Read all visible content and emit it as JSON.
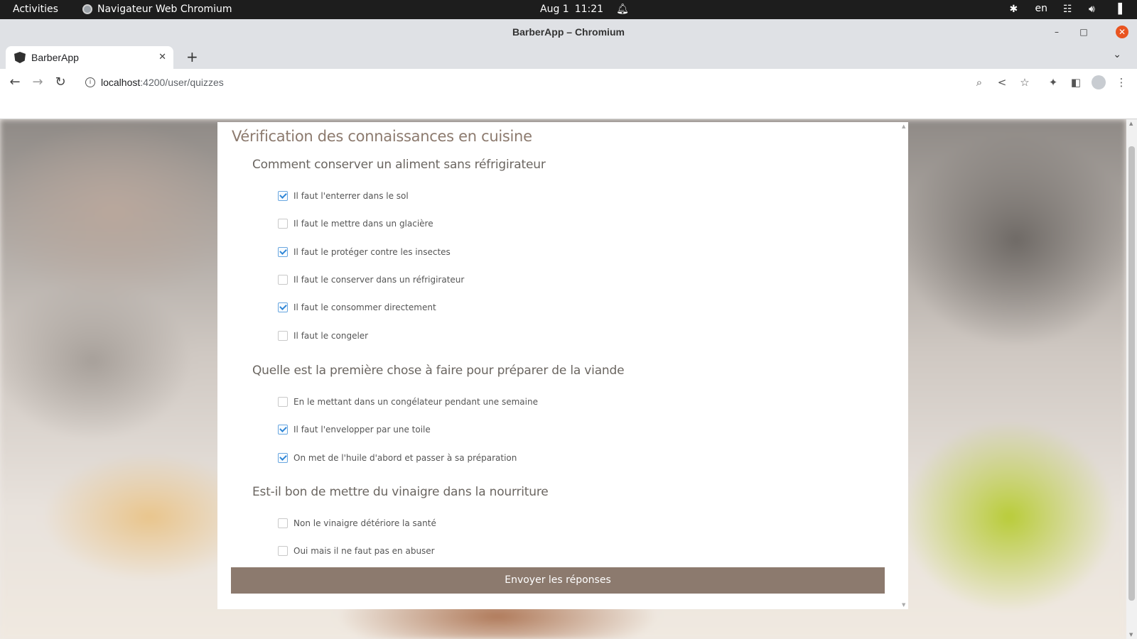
{
  "system_bar": {
    "activities": "Activities",
    "app_name": "Navigateur Web Chromium",
    "date": "Aug 1",
    "time": "11:21",
    "language": "en"
  },
  "window": {
    "title": "BarberApp – Chromium"
  },
  "tab": {
    "title": "BarberApp"
  },
  "address_bar": {
    "host": "localhost",
    "path": ":4200/user/quizzes"
  },
  "quiz": {
    "title": "Vérification des connaissances en cuisine",
    "questions": [
      {
        "text": "Comment conserver un aliment sans réfrigirateur",
        "options": [
          {
            "label": "Il faut l'enterrer dans le sol",
            "checked": true
          },
          {
            "label": "Il faut le mettre dans un glacière",
            "checked": false
          },
          {
            "label": "Il faut le protéger contre les insectes",
            "checked": true
          },
          {
            "label": "Il faut le conserver dans un réfrigirateur",
            "checked": false
          },
          {
            "label": "Il faut le consommer directement",
            "checked": true
          },
          {
            "label": "Il faut le congeler",
            "checked": false
          }
        ]
      },
      {
        "text": "Quelle est la première chose à faire pour préparer de la viande",
        "options": [
          {
            "label": "En le mettant dans un congélateur pendant une semaine",
            "checked": false
          },
          {
            "label": "Il faut l'envelopper par une toile",
            "checked": true
          },
          {
            "label": "On met de l'huile d'abord et passer à sa préparation",
            "checked": true
          }
        ]
      },
      {
        "text": "Est-il bon de mettre du vinaigre dans la nourriture",
        "options": [
          {
            "label": "Non le vinaigre détériore la santé",
            "checked": false
          },
          {
            "label": "Oui mais il ne faut pas en abuser",
            "checked": false
          }
        ]
      }
    ],
    "submit_label": "Envoyer les réponses"
  },
  "colors": {
    "accent": "#8c7a6e",
    "checkbox_checked": "#2f86d6"
  }
}
